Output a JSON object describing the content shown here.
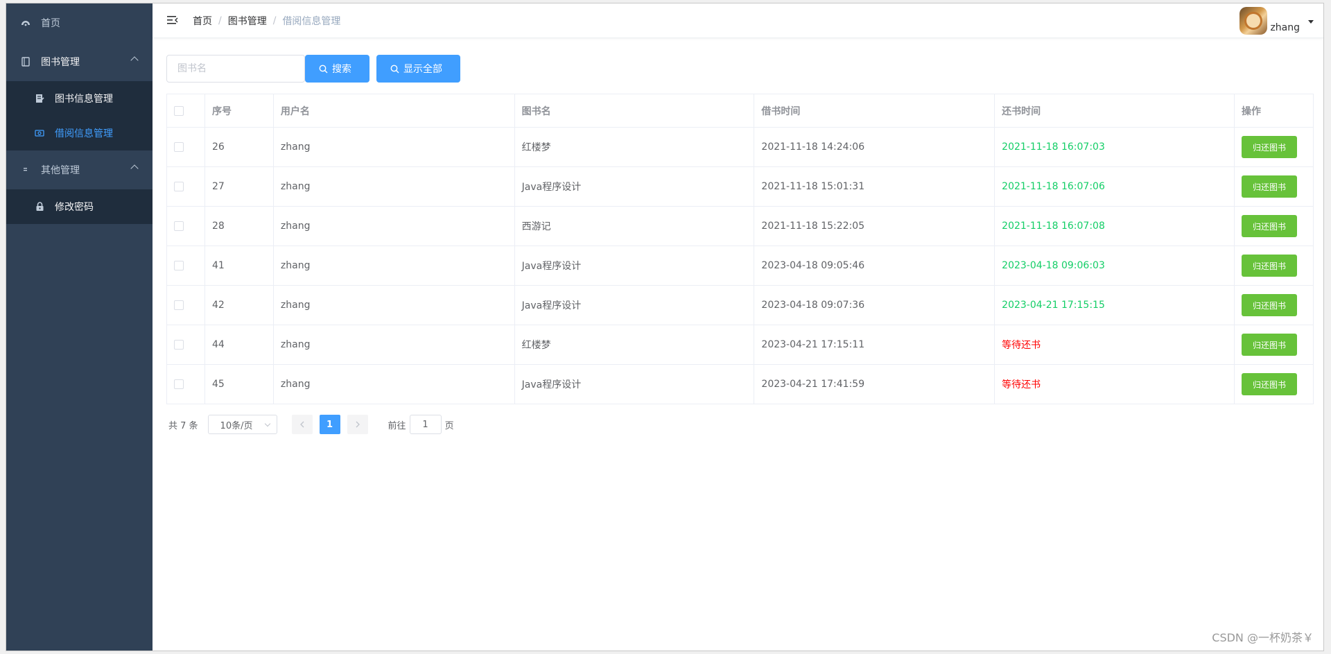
{
  "sidebar": {
    "items": [
      {
        "label": "首页",
        "icon": "dashboard-icon"
      },
      {
        "label": "图书管理",
        "icon": "book-icon",
        "expanded": true,
        "children": [
          {
            "label": "图书信息管理",
            "icon": "document-icon"
          },
          {
            "label": "借阅信息管理",
            "icon": "borrow-icon",
            "active": true
          }
        ]
      },
      {
        "label": "其他管理",
        "icon": "list-icon",
        "expanded": true,
        "children": [
          {
            "label": "修改密码",
            "icon": "lock-icon"
          }
        ]
      }
    ],
    "colors": {
      "bg": "#304156",
      "sub_bg": "#1f2d3d",
      "active": "#409eff"
    }
  },
  "header": {
    "breadcrumb": [
      "首页",
      "图书管理",
      "借阅信息管理"
    ],
    "breadcrumb_separator": "/",
    "username": "zhang"
  },
  "toolbar": {
    "search_placeholder": "图书名",
    "search_value": "",
    "search_button": "搜索",
    "show_all_button": "显示全部"
  },
  "table": {
    "columns": [
      "序号",
      "用户名",
      "图书名",
      "借书时间",
      "还书时间",
      "操作"
    ],
    "rows": [
      {
        "id": "26",
        "user": "zhang",
        "book": "红楼梦",
        "borrow_time": "2021-11-18 14:24:06",
        "return_time": "2021-11-18 16:07:03",
        "returned": true,
        "action": "归还图书"
      },
      {
        "id": "27",
        "user": "zhang",
        "book": "Java程序设计",
        "borrow_time": "2021-11-18 15:01:31",
        "return_time": "2021-11-18 16:07:06",
        "returned": true,
        "action": "归还图书"
      },
      {
        "id": "28",
        "user": "zhang",
        "book": "西游记",
        "borrow_time": "2021-11-18 15:22:05",
        "return_time": "2021-11-18 16:07:08",
        "returned": true,
        "action": "归还图书"
      },
      {
        "id": "41",
        "user": "zhang",
        "book": "Java程序设计",
        "borrow_time": "2023-04-18 09:05:46",
        "return_time": "2023-04-18 09:06:03",
        "returned": true,
        "action": "归还图书"
      },
      {
        "id": "42",
        "user": "zhang",
        "book": "Java程序设计",
        "borrow_time": "2023-04-18 09:07:36",
        "return_time": "2023-04-21 17:15:15",
        "returned": true,
        "action": "归还图书"
      },
      {
        "id": "44",
        "user": "zhang",
        "book": "红楼梦",
        "borrow_time": "2023-04-21 17:15:11",
        "return_time": "等待还书",
        "returned": false,
        "action": "归还图书"
      },
      {
        "id": "45",
        "user": "zhang",
        "book": "Java程序设计",
        "borrow_time": "2023-04-21 17:41:59",
        "return_time": "等待还书",
        "returned": false,
        "action": "归还图书"
      }
    ],
    "colors": {
      "returned": "#1aad19",
      "pending": "#ff0000",
      "action_button": "#67c23a"
    }
  },
  "pagination": {
    "total_text": "共 7 条",
    "page_size": "10条/页",
    "current_page": "1",
    "goto_prefix": "前往",
    "goto_value": "1",
    "goto_suffix": "页"
  },
  "watermark": "CSDN @一杯奶茶￥"
}
